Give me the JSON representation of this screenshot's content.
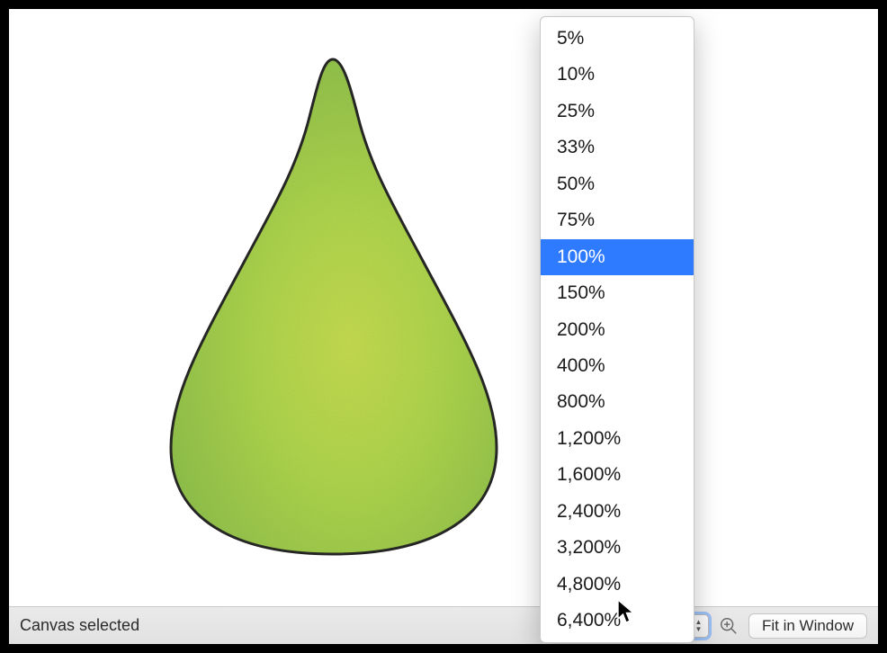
{
  "status": {
    "text": "Canvas selected"
  },
  "zoom": {
    "value": "100%",
    "fit_label": "Fit in Window",
    "options": [
      "5%",
      "10%",
      "25%",
      "33%",
      "50%",
      "75%",
      "100%",
      "150%",
      "200%",
      "400%",
      "800%",
      "1,200%",
      "1,600%",
      "2,400%",
      "3,200%",
      "4,800%",
      "6,400%"
    ],
    "selected_index": 6
  },
  "icons": {
    "zoom_out": "zoom-out-icon",
    "zoom_in": "zoom-in-icon"
  }
}
